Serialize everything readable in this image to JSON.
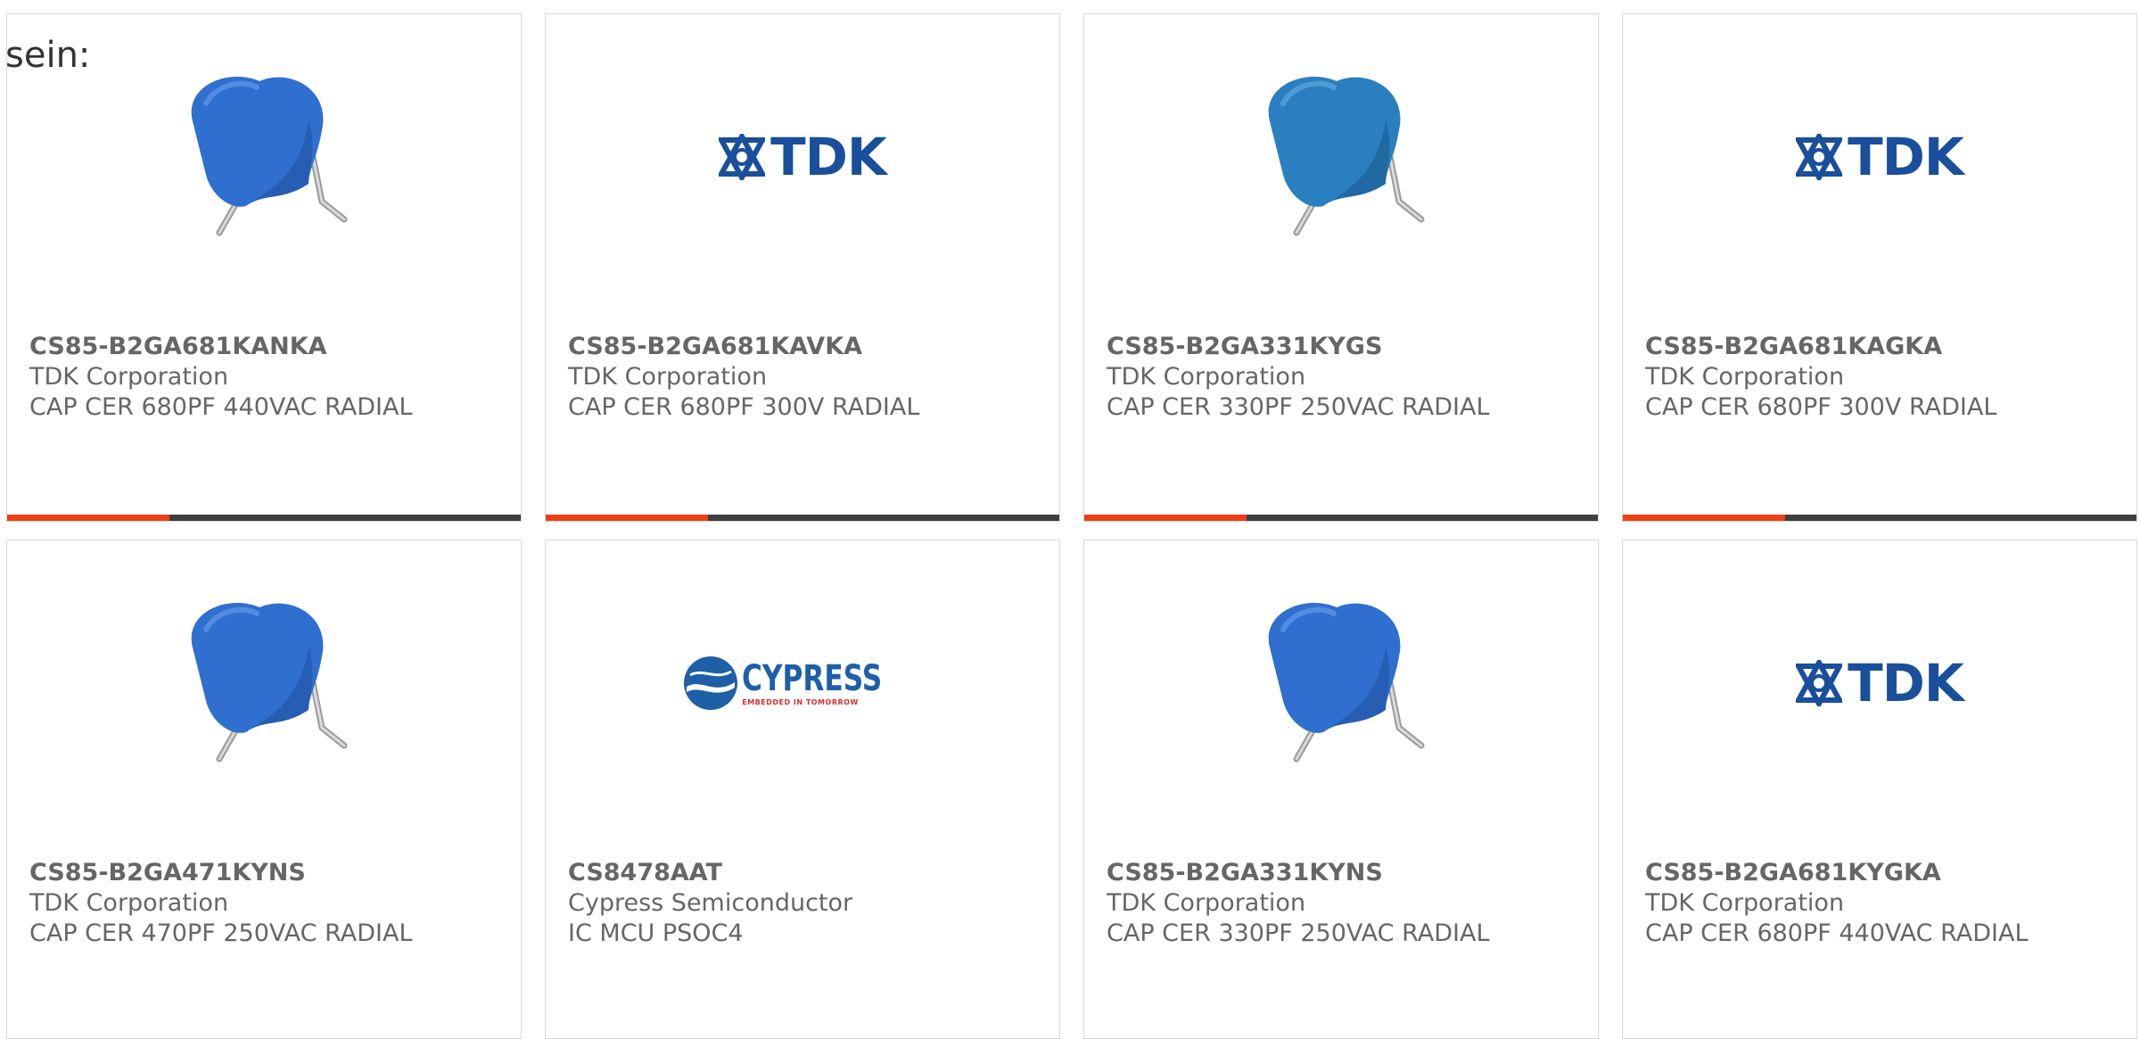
{
  "page": {
    "lead_text": "sein:"
  },
  "colors": {
    "accent": "#ef3e14",
    "bar": "#3f3f3f",
    "text": "#666666",
    "capacitor_blue": "#2f6fd0",
    "tdk_blue": "#1a4f9c",
    "cypress_red": "#d32f2f"
  },
  "cards": [
    {
      "image": "blue-capacitor-image",
      "part_number": "CS85-B2GA681KANKA",
      "manufacturer": "TDK Corporation",
      "description": "CAP CER 680PF 440VAC RADIAL"
    },
    {
      "image": "tdk-logo",
      "logo_text": "TDK",
      "part_number": "CS85-B2GA681KAVKA",
      "manufacturer": "TDK Corporation",
      "description": "CAP CER 680PF 300V RADIAL"
    },
    {
      "image": "teal-capacitor-image",
      "part_number": "CS85-B2GA331KYGS",
      "manufacturer": "TDK Corporation",
      "description": "CAP CER 330PF 250VAC RADIAL"
    },
    {
      "image": "tdk-logo",
      "logo_text": "TDK",
      "part_number": "CS85-B2GA681KAGKA",
      "manufacturer": "TDK Corporation",
      "description": "CAP CER 680PF 300V RADIAL"
    },
    {
      "image": "blue-capacitor-image",
      "part_number": "CS85-B2GA471KYNS",
      "manufacturer": "TDK Corporation",
      "description": "CAP CER 470PF 250VAC RADIAL"
    },
    {
      "image": "cypress-logo",
      "logo_text": "CYPRESS",
      "logo_tagline": "EMBEDDED IN TOMORROW",
      "part_number": "CS8478AAT",
      "manufacturer": "Cypress Semiconductor",
      "description": "IC MCU PSOC4"
    },
    {
      "image": "blue-capacitor-image",
      "part_number": "CS85-B2GA331KYNS",
      "manufacturer": "TDK Corporation",
      "description": "CAP CER 330PF 250VAC RADIAL"
    },
    {
      "image": "tdk-logo",
      "logo_text": "TDK",
      "part_number": "CS85-B2GA681KYGKA",
      "manufacturer": "TDK Corporation",
      "description": "CAP CER 680PF 440VAC RADIAL"
    }
  ]
}
